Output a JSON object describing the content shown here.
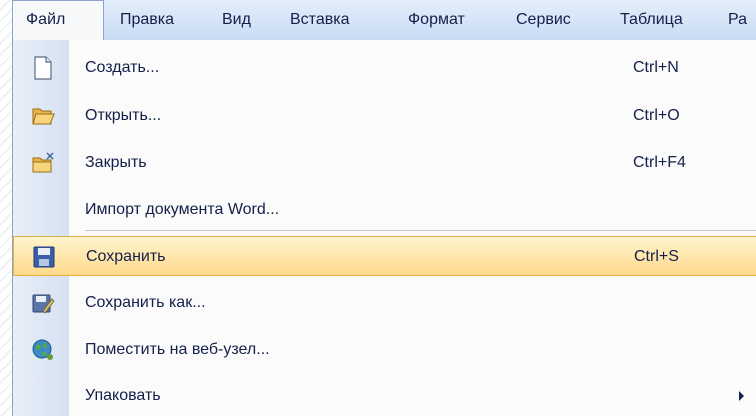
{
  "menubar": {
    "items": [
      {
        "label": "Файл",
        "active": true
      },
      {
        "label": "Правка"
      },
      {
        "label": "Вид"
      },
      {
        "label": "Вставка"
      },
      {
        "label": "Формат"
      },
      {
        "label": "Сервис"
      },
      {
        "label": "Таблица"
      },
      {
        "label": "Ра"
      }
    ]
  },
  "file_menu": {
    "items": [
      {
        "label": "Создать...",
        "shortcut": "Ctrl+N",
        "icon": "new-document-icon"
      },
      {
        "label": "Открыть...",
        "shortcut": "Ctrl+O",
        "icon": "open-folder-icon"
      },
      {
        "label": "Закрыть",
        "shortcut": "Ctrl+F4",
        "icon": "close-folder-icon"
      },
      {
        "label": "Импорт документа Word...",
        "shortcut": "",
        "icon": ""
      },
      {
        "label": "Сохранить",
        "shortcut": "Ctrl+S",
        "icon": "save-icon",
        "highlighted": true
      },
      {
        "label": "Сохранить как...",
        "shortcut": "",
        "icon": "save-as-icon"
      },
      {
        "label": "Поместить на веб-узел...",
        "shortcut": "",
        "icon": "web-globe-icon"
      },
      {
        "label": "Упаковать",
        "shortcut": "",
        "icon": "",
        "submenu": true
      }
    ]
  },
  "colors": {
    "menubar_bg": "#c8dcf5",
    "highlight_bg": "#ffd98a",
    "highlight_border": "#e3b04b",
    "text": "#14204a"
  }
}
